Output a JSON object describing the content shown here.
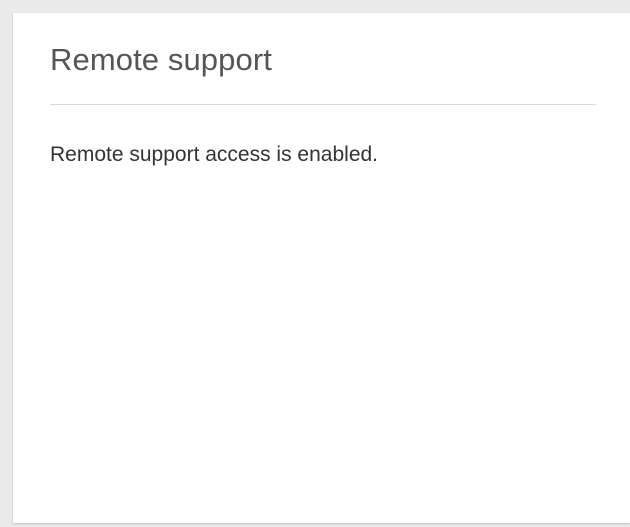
{
  "panel": {
    "title": "Remote support",
    "status_message": "Remote support access is enabled."
  }
}
